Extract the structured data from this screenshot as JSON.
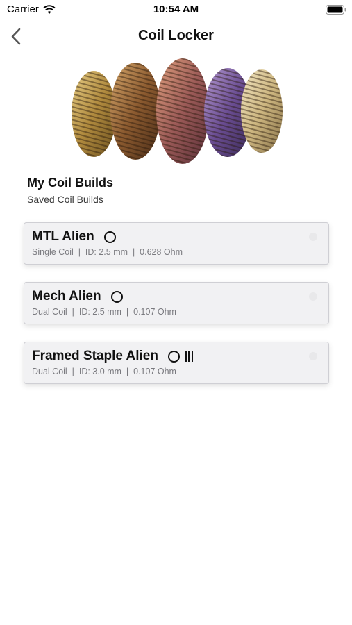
{
  "status_bar": {
    "carrier": "Carrier",
    "time": "10:54 AM"
  },
  "nav": {
    "title": "Coil Locker",
    "back_icon": "chevron-left-icon"
  },
  "header": {
    "title": "My Coil Builds",
    "subtitle": "Saved Coil Builds"
  },
  "builds": [
    {
      "name": "MTL Alien",
      "details": "Single Coil  |  ID: 2.5 mm  |  0.628 Ohm",
      "icons": [
        "ring-icon"
      ]
    },
    {
      "name": "Mech Alien",
      "details": "Dual Coil  |  ID: 2.5 mm  |  0.107 Ohm",
      "icons": [
        "ring-icon"
      ]
    },
    {
      "name": "Framed Staple Alien",
      "details": "Dual Coil  |  ID: 3.0 mm  |  0.107 Ohm",
      "icons": [
        "ring-icon",
        "bars-icon"
      ]
    }
  ],
  "colors": {
    "card_bg": "#f1f1f3",
    "card_border": "#cfcfd4",
    "subtext": "#7a7a7f"
  }
}
